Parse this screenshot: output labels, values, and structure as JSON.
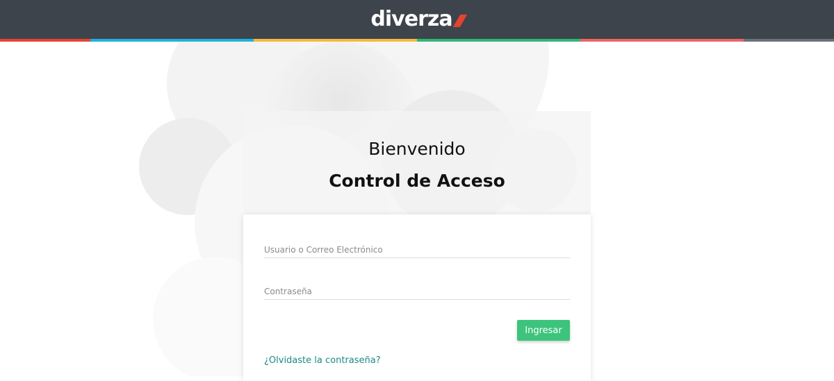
{
  "header": {
    "logo_text": "diverza",
    "logo_accent_color": "#e5432f",
    "background_color": "#3d444c",
    "stripe_colors": [
      "#e5432f",
      "#1fb0de",
      "#f5b940",
      "#33b577",
      "#f06363",
      "#6b7178"
    ]
  },
  "login": {
    "welcome": "Bienvenido",
    "title": "Control de Acceso",
    "username_placeholder": "Usuario o Correo Electrónico",
    "password_placeholder": "Contraseña",
    "submit_label": "Ingresar",
    "forgot_link": "¿Olvidaste la contraseña?",
    "button_color": "#3cc47c",
    "link_color": "#1a8a82"
  }
}
